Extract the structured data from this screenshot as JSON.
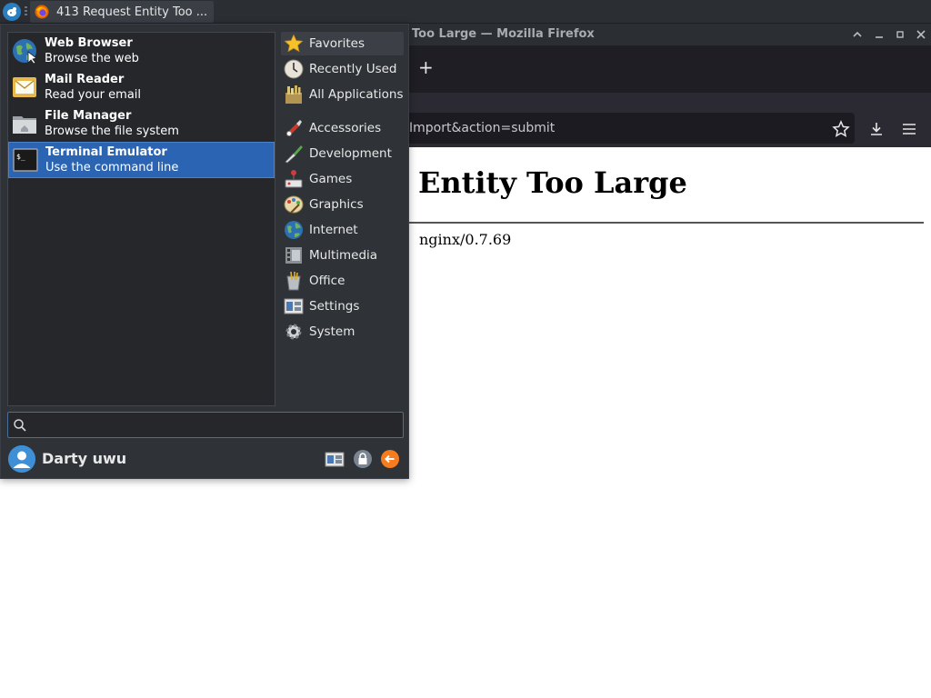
{
  "taskbar": {
    "task_title": "413 Request Entity Too ..."
  },
  "firefox": {
    "window_title": "Too Large — Mozilla Firefox",
    "new_tab_symbol": "+",
    "url_text": "Import&action=submit",
    "page": {
      "heading": "st Entity Too Large",
      "footer": "nginx/0.7.69"
    }
  },
  "menu": {
    "favorites": [
      {
        "name": "Web Browser",
        "desc": "Browse the web",
        "icon": "globe-icon",
        "selected": false
      },
      {
        "name": "Mail Reader",
        "desc": "Read your email",
        "icon": "mail-icon",
        "selected": false
      },
      {
        "name": "File Manager",
        "desc": "Browse the file system",
        "icon": "folder-icon",
        "selected": false
      },
      {
        "name": "Terminal Emulator",
        "desc": "Use the command line",
        "icon": "terminal-icon",
        "selected": true
      }
    ],
    "categories": [
      {
        "label": "Favorites",
        "icon": "star-icon"
      },
      {
        "label": "Recently Used",
        "icon": "clock-icon"
      },
      {
        "label": "All Applications",
        "icon": "applications-icon"
      },
      {
        "label": "Accessories",
        "icon": "accessories-icon"
      },
      {
        "label": "Development",
        "icon": "development-icon"
      },
      {
        "label": "Games",
        "icon": "games-icon"
      },
      {
        "label": "Graphics",
        "icon": "graphics-icon"
      },
      {
        "label": "Internet",
        "icon": "internet-icon"
      },
      {
        "label": "Multimedia",
        "icon": "multimedia-icon"
      },
      {
        "label": "Office",
        "icon": "office-icon"
      },
      {
        "label": "Settings",
        "icon": "settings-icon"
      },
      {
        "label": "System",
        "icon": "system-icon"
      }
    ],
    "search": {
      "value": "",
      "placeholder": ""
    },
    "user": {
      "name": "Darty uwu"
    }
  },
  "colors": {
    "selection": "#2a64b3",
    "panel": "#2b2e33",
    "menu_bg": "#2f3237"
  }
}
